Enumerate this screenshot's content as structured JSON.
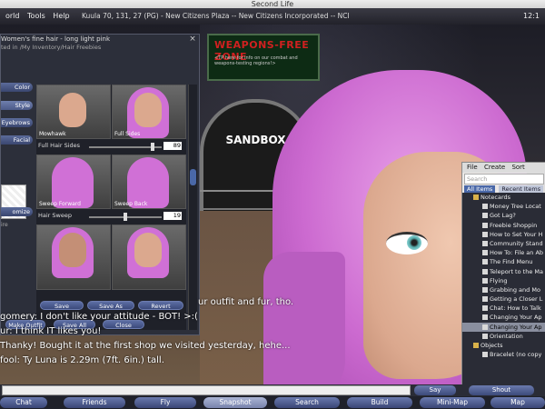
{
  "window": {
    "title": "Second Life"
  },
  "menu": {
    "items": [
      "orld",
      "Tools",
      "Help"
    ],
    "region": "Kuula 70, 131, 27 (PG) - New Citizens Plaza -- New Citizens Incorporated -- NCI",
    "clock": "12:1"
  },
  "scene": {
    "sign_title": "WEAPONS-FREE ZONE",
    "sign_text": "<TP here for info on our combat and weapons-testing regions!>",
    "dome_label": "SANDBOX"
  },
  "appearance": {
    "title": "Women's fine hair - long light pink",
    "path": "ted in /My Inventory/Hair Freebies",
    "close": "×",
    "side_buttons": [
      "Color",
      "Style",
      "Eyebrows",
      "Facial",
      "omize"
    ],
    "swatch_label": "ire",
    "thumbs": [
      {
        "label": "Mowhawk"
      },
      {
        "label": "Full Sides"
      },
      {
        "label": "Sweep Forward"
      },
      {
        "label": "Sweep Back"
      },
      {
        "label": ""
      },
      {
        "label": ""
      }
    ],
    "sliders": [
      {
        "label": "Full Hair Sides",
        "value": "89",
        "fraction": 0.89
      },
      {
        "label": "Hair Sweep",
        "value": "19",
        "fraction": 0.5
      }
    ],
    "buttons": {
      "save": "Save",
      "save_as": "Save As",
      "revert": "Revert"
    },
    "bottom_buttons": {
      "make_outfit": "Make Outfit",
      "save_all": "Save All",
      "close": "Close"
    }
  },
  "chat": [
    "ur outfit and fur, tho.",
    "gomery: I don't like your attitude - BOT! >:(",
    "ur: I think IT likes you!",
    "Thanky! Bought it at the first shop we visited yesterday, hehe...",
    "fool: Ty Luna is 2.29m (7ft. 6in.) tall."
  ],
  "inventory": {
    "menu": [
      "File",
      "Create",
      "Sort"
    ],
    "search_placeholder": "Search",
    "tabs": [
      "All Items",
      "Recent Items"
    ],
    "rows": [
      {
        "text": "Notecards",
        "folder": true
      },
      {
        "text": "Money Tree Locat",
        "folder": false
      },
      {
        "text": "Got Lag?",
        "folder": false
      },
      {
        "text": "Freebie Shoppin",
        "folder": false
      },
      {
        "text": "How to Set Your H",
        "folder": false
      },
      {
        "text": "Community Stand",
        "folder": false
      },
      {
        "text": "How To: File an Ab",
        "folder": false
      },
      {
        "text": "The Find Menu",
        "folder": false
      },
      {
        "text": "Teleport to the Ma",
        "folder": false
      },
      {
        "text": "Flying",
        "folder": false
      },
      {
        "text": "Grabbing and Mo",
        "folder": false
      },
      {
        "text": "Getting a Closer L",
        "folder": false
      },
      {
        "text": "Chat: How to Talk",
        "folder": false
      },
      {
        "text": "Changing Your Ap",
        "folder": false
      },
      {
        "text": "Changing Your Ap",
        "folder": false,
        "highlight": true
      },
      {
        "text": "Orientation",
        "folder": false
      },
      {
        "text": "Objects",
        "folder": true
      },
      {
        "text": "Bracelet (no copy",
        "folder": false
      }
    ]
  },
  "chatbar": {
    "say": "Say",
    "shout": "Shout"
  },
  "toolbar": [
    "Chat",
    "Friends",
    "Fly",
    "Snapshot",
    "Search",
    "Build",
    "Mini-Map",
    "Map"
  ]
}
